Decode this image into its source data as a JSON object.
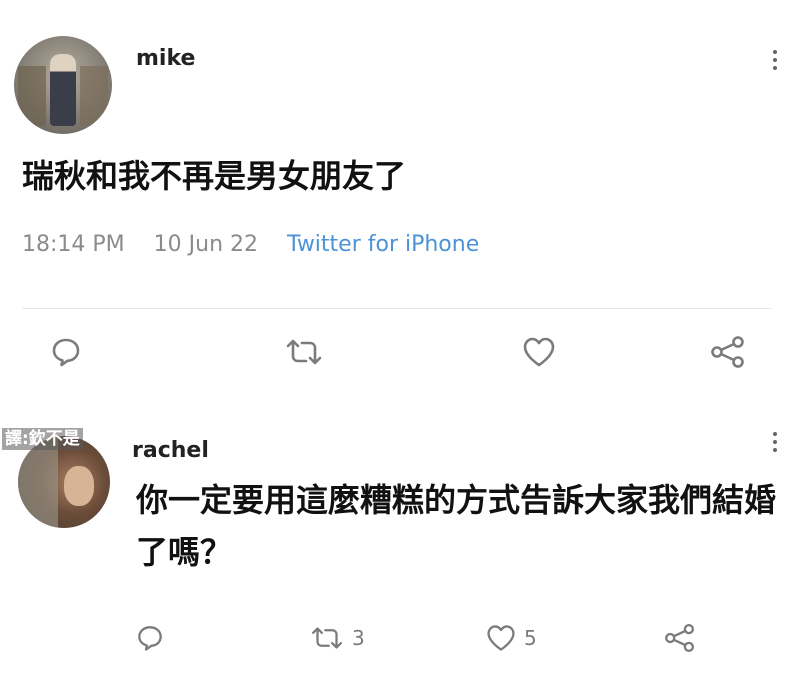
{
  "main_tweet": {
    "username": "mike",
    "text": "瑞秋和我不再是男女朋友了",
    "time": "18:14 PM",
    "date": "10 Jun 22",
    "source": "Twitter for iPhone"
  },
  "reply_tweet": {
    "overlay_label": "譯:欽不是",
    "username": "rachel",
    "text": "你一定要用這麼糟糕的方式告訴大家我們結婚了嗎？",
    "retweet_count": "3",
    "like_count": "5"
  },
  "icons": {
    "reply": "reply-icon",
    "retweet": "retweet-icon",
    "like": "heart-icon",
    "share": "share-icon",
    "more": "more-vertical-icon"
  },
  "colors": {
    "source_link": "#4b93d6",
    "meta_gray": "#8b8b8b"
  }
}
